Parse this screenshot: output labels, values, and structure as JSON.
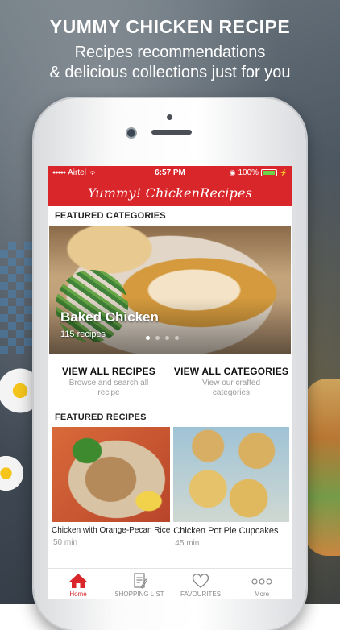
{
  "promo": {
    "headline": "YUMMY CHICKEN RECIPE",
    "subline_1": "Recipes recommendations",
    "subline_2": "& delicious collections just for you"
  },
  "status_bar": {
    "carrier": "Airtel",
    "time": "6:57 PM",
    "battery": "100%"
  },
  "app": {
    "title": "Yummy! ChickenRecipes",
    "accent_color": "#d8262b"
  },
  "featured_categories": {
    "heading": "FEATURED CATEGORIES",
    "hero": {
      "name": "Baked Chicken",
      "count": "115 recipes"
    },
    "carousel_page_count": 4,
    "carousel_active_page": 1
  },
  "links": [
    {
      "title": "VIEW ALL RECIPES",
      "desc": "Browse and search all recipe"
    },
    {
      "title": "VIEW ALL CATEGORIES",
      "desc": "View our crafted categories"
    }
  ],
  "featured_recipes": {
    "heading": "FEATURED RECIPES",
    "items": [
      {
        "title": "Chicken with Orange-Pecan Rice",
        "time": "50 min"
      },
      {
        "title": "Chicken Pot Pie Cupcakes",
        "time": "45 min"
      }
    ]
  },
  "tabbar": [
    {
      "label": "Home",
      "icon": "home-icon",
      "active": true
    },
    {
      "label": "SHOPPING LIST",
      "icon": "shopping-list-icon",
      "active": false
    },
    {
      "label": "FAVOURITES",
      "icon": "heart-icon",
      "active": false
    },
    {
      "label": "More",
      "icon": "more-icon",
      "active": false
    }
  ]
}
